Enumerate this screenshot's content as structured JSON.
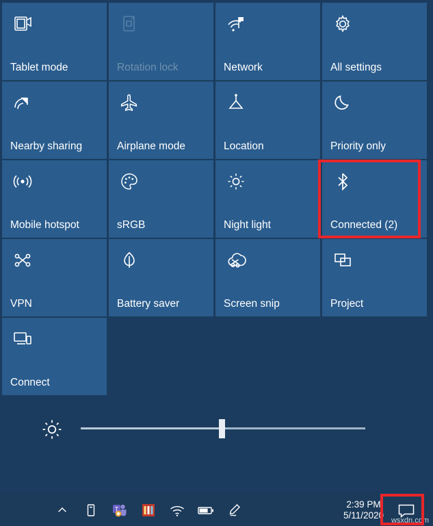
{
  "action_center": {
    "background_color": "#1b3c5e",
    "tile_color": "#2a5c8d",
    "tiles": [
      {
        "id": "tablet-mode",
        "label": "Tablet mode",
        "icon": "tablet-mode-icon",
        "state": "enabled"
      },
      {
        "id": "rotation-lock",
        "label": "Rotation lock",
        "icon": "rotation-lock-icon",
        "state": "disabled"
      },
      {
        "id": "network",
        "label": "Network",
        "icon": "network-icon",
        "state": "enabled"
      },
      {
        "id": "all-settings",
        "label": "All settings",
        "icon": "gear-icon",
        "state": "enabled"
      },
      {
        "id": "nearby-sharing",
        "label": "Nearby sharing",
        "icon": "nearby-sharing-icon",
        "state": "enabled"
      },
      {
        "id": "airplane-mode",
        "label": "Airplane mode",
        "icon": "airplane-icon",
        "state": "enabled"
      },
      {
        "id": "location",
        "label": "Location",
        "icon": "location-icon",
        "state": "enabled"
      },
      {
        "id": "priority-only",
        "label": "Priority only",
        "icon": "moon-icon",
        "state": "enabled"
      },
      {
        "id": "mobile-hotspot",
        "label": "Mobile hotspot",
        "icon": "hotspot-icon",
        "state": "enabled"
      },
      {
        "id": "srgb",
        "label": "sRGB",
        "icon": "color-palette-icon",
        "state": "enabled"
      },
      {
        "id": "night-light",
        "label": "Night light",
        "icon": "sun-icon",
        "state": "enabled"
      },
      {
        "id": "bluetooth",
        "label": "Connected (2)",
        "icon": "bluetooth-icon",
        "state": "enabled"
      },
      {
        "id": "vpn",
        "label": "VPN",
        "icon": "vpn-icon",
        "state": "enabled"
      },
      {
        "id": "battery-saver",
        "label": "Battery saver",
        "icon": "leaf-icon",
        "state": "enabled"
      },
      {
        "id": "screen-snip",
        "label": "Screen snip",
        "icon": "screen-snip-icon",
        "state": "enabled"
      },
      {
        "id": "project",
        "label": "Project",
        "icon": "project-icon",
        "state": "enabled"
      },
      {
        "id": "connect",
        "label": "Connect",
        "icon": "connect-icon",
        "state": "enabled"
      }
    ],
    "brightness": {
      "icon": "brightness-sun-icon",
      "value_percent": 49
    }
  },
  "highlights": [
    {
      "id": "bluetooth-tile-highlight",
      "color": "#e8262b"
    },
    {
      "id": "action-center-tray-highlight",
      "color": "#e8262b"
    }
  ],
  "taskbar": {
    "show_hidden_icons": "chevron-up-icon",
    "tray_icons": [
      "usb-eject-icon",
      "microsoft-teams-icon",
      "app-colored-icon",
      "wifi-icon",
      "battery-icon",
      "pen-workspace-icon"
    ],
    "clock": {
      "time": "2:39 PM",
      "date": "5/11/2020"
    },
    "action_center_icon": "action-center-icon"
  },
  "watermark": "wsxdn.com"
}
